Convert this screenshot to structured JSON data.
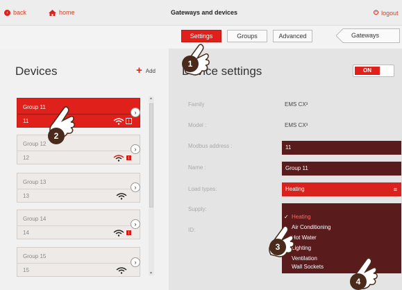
{
  "topbar": {
    "back_label": "back",
    "home_label": "home",
    "title": "Gateways and devices",
    "logout_label": "logout"
  },
  "tabs": [
    {
      "label": "Settings",
      "active": true
    },
    {
      "label": "Groups",
      "active": false
    },
    {
      "label": "Advanced",
      "active": false
    },
    {
      "label": "Gateways",
      "active": false
    }
  ],
  "left": {
    "heading": "Devices",
    "add_label": "Add",
    "groups": [
      {
        "name": "Group 11",
        "id": "11",
        "signal": true,
        "badge": "I",
        "active": true
      },
      {
        "name": "Group 12",
        "id": "12",
        "signal": true,
        "badge": "I",
        "active": false
      },
      {
        "name": "Group 13",
        "id": "13",
        "signal": true,
        "badge": "",
        "active": false
      },
      {
        "name": "Group 14",
        "id": "14",
        "signal": true,
        "badge": "I",
        "active": false
      },
      {
        "name": "Group 15",
        "id": "15",
        "signal": true,
        "badge": "",
        "active": false
      }
    ]
  },
  "right": {
    "heading": "Device settings",
    "toggle_label": "ON",
    "rows": {
      "family_label": "Family",
      "family_value": "EMS CX³",
      "model_label": "Model :",
      "model_value": "EMS CX³",
      "modbus_label": "Modbus address :",
      "modbus_value": "11",
      "name_label": "Name :",
      "name_value": "Group 11",
      "load_label": "Load types:",
      "load_value": "Heating",
      "supply_label": "Supply:",
      "id_label": "ID:"
    },
    "dropdown_options": [
      {
        "label": "Heating",
        "selected": true
      },
      {
        "label": "Air Conditioning",
        "selected": false
      },
      {
        "label": "Hot Water",
        "selected": false
      },
      {
        "label": "Lighting",
        "selected": false
      },
      {
        "label": "Ventilation",
        "selected": false
      },
      {
        "label": "Wall Sockets",
        "selected": false
      }
    ]
  },
  "annotations": [
    "1",
    "2",
    "3",
    "4"
  ],
  "colors": {
    "accent": "#e0201a",
    "dark_field": "#5a1b1d",
    "panel_bg": "#e4e4e4"
  }
}
